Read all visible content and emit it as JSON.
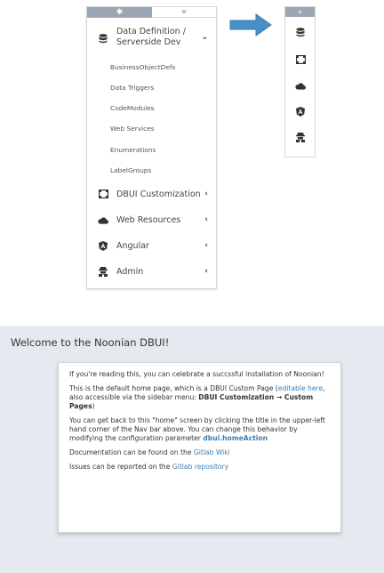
{
  "sidebar": {
    "gear_icon": "gear-icon",
    "collapse_glyph": "«",
    "group": {
      "label": "Data Definition / Serverside Dev",
      "chevron": "⌄"
    },
    "sub_items": [
      "BusinessObjectDefs",
      "Data Triggers",
      "CodeModules",
      "Web Services",
      "Enumerations",
      "LabelGroups"
    ],
    "items": [
      {
        "label": "DBUI Customization",
        "icon": "layout-icon",
        "chevron": "‹"
      },
      {
        "label": "Web Resources",
        "icon": "cloud-icon",
        "chevron": "‹"
      },
      {
        "label": "Angular",
        "icon": "angular-icon",
        "chevron": "‹"
      },
      {
        "label": "Admin",
        "icon": "admin-icon",
        "chevron": "‹"
      }
    ]
  },
  "mini_sidebar": {
    "expand_glyph": "»",
    "icons": [
      "database-icon",
      "layout-icon",
      "cloud-icon",
      "angular-icon",
      "admin-icon"
    ]
  },
  "welcome": {
    "title": "Welcome to the Noonian DBUI!",
    "p1": "If you're reading this, you can celebrate a succssful installation of Noonian!",
    "p2_a": "This is the default home page, which is a DBUI Custom Page (",
    "p2_link": "editable here",
    "p2_b": ", also accessible via the sidebar menu: ",
    "p2_menu": "DBUI Customization → Custom Pages",
    "p2_c": ")",
    "p3_a": "You can get back to this \"home\" screen by clicking the title in the upper-left hand corner of the Nav bar above. You can change this behavior by modifying the configuration parameter ",
    "p3_param": "dbui.homeAction",
    "p4_a": "Documentation can be found on the ",
    "p4_link": "Gitlab Wiki",
    "p5_a": "Issues can be reported on the ",
    "p5_link": "Gitlab repository"
  },
  "colors": {
    "accent": "#4a90c8",
    "header_gray": "#9aa7b3",
    "icon_dark": "#333333",
    "band": "#e6eaf0"
  }
}
